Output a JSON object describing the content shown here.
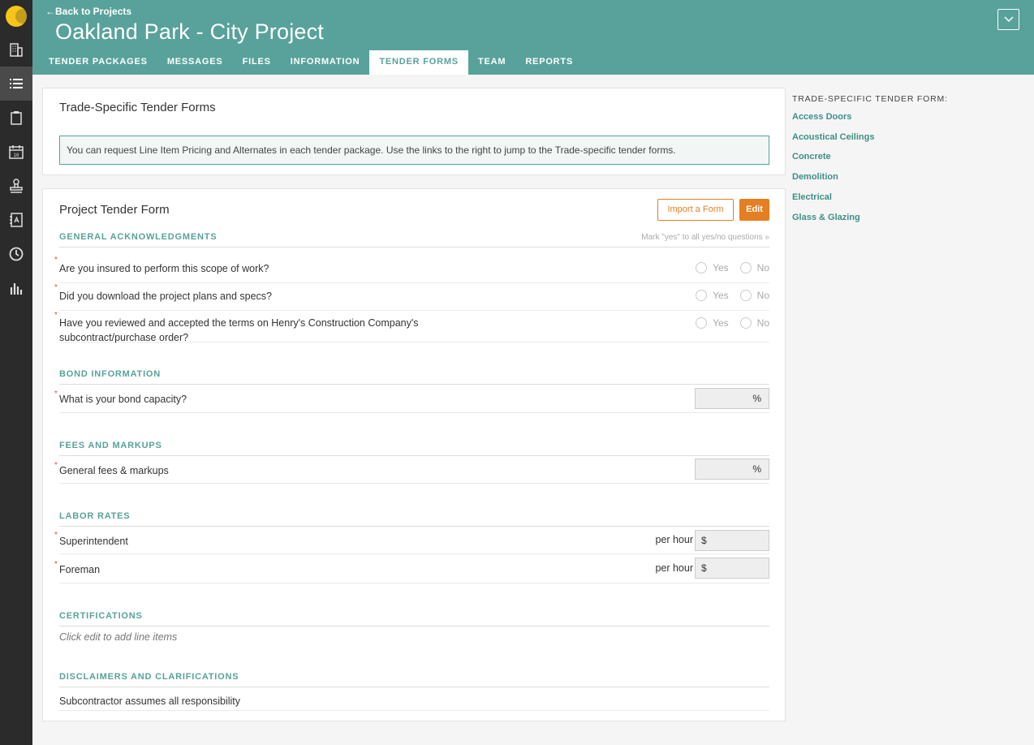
{
  "nav": {
    "back_label": "Back to Projects",
    "project_title": "Oakland Park - City Project",
    "tabs": [
      {
        "label": "TENDER PACKAGES"
      },
      {
        "label": "MESSAGES"
      },
      {
        "label": "FILES"
      },
      {
        "label": "INFORMATION"
      },
      {
        "label": "TENDER FORMS",
        "active": true
      },
      {
        "label": "TEAM"
      },
      {
        "label": "REPORTS"
      }
    ]
  },
  "rail": {
    "icons": [
      "building-icon",
      "list-icon",
      "clipboard-icon",
      "calendar-icon",
      "stamp-icon",
      "address-book-icon",
      "clock-icon",
      "bar-chart-icon"
    ],
    "calendar_day": "16"
  },
  "trade_forms": {
    "title": "Trade-Specific Tender Forms",
    "info": "You can request Line Item Pricing and Alternates in each tender package. Use the links to the right to jump to the Trade-specific tender forms."
  },
  "project_form": {
    "title": "Project Tender Form",
    "import_label": "Import a Form",
    "edit_label": "Edit",
    "general": {
      "heading": "GENERAL ACKNOWLEDGMENTS",
      "mark_all": "Mark \"yes\" to all yes/no questions »",
      "yes_label": "Yes",
      "no_label": "No",
      "questions": [
        {
          "text": "Are you insured to perform this scope of work?"
        },
        {
          "text": "Did you download the project plans and specs?"
        },
        {
          "text": "Have you reviewed and accepted the terms on Henry's Construction Company's",
          "text2": "subcontract/purchase order?"
        }
      ]
    },
    "bond": {
      "heading": "BOND INFORMATION",
      "question": "What is your bond capacity?",
      "unit": "%"
    },
    "fees": {
      "heading": "FEES AND MARKUPS",
      "question": "General fees & markups",
      "unit": "%"
    },
    "labor": {
      "heading": "LABOR RATES",
      "per_hour": "per hour",
      "currency": "$",
      "rows": [
        {
          "label": "Superintendent"
        },
        {
          "label": "Foreman"
        }
      ]
    },
    "certifications": {
      "heading": "CERTIFICATIONS",
      "hint": "Click edit to add line items"
    },
    "disclaimers": {
      "heading": "DISCLAIMERS AND CLARIFICATIONS",
      "text": "Subcontractor assumes all responsibility"
    }
  },
  "sidebar": {
    "title": "TRADE-SPECIFIC TENDER FORM:",
    "links": [
      "Access Doors",
      "Acoustical Ceilings",
      "Concrete",
      "Demolition",
      "Electrical",
      "Glass & Glazing"
    ]
  },
  "colors": {
    "header": "#58a29b",
    "accent": "#e67e22",
    "rail": "#2b2b2b"
  }
}
